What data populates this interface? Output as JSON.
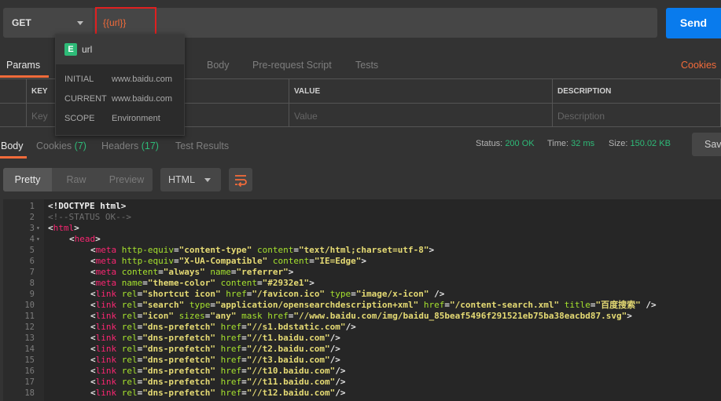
{
  "request": {
    "method": "GET",
    "url": "{{url}}",
    "send_label": "Send"
  },
  "request_tabs": [
    "Params",
    "Body",
    "Pre-request Script",
    "Tests"
  ],
  "cookies_link": "Cookies",
  "params_table": {
    "headers": [
      "KEY",
      "VALUE",
      "DESCRIPTION"
    ],
    "placeholders": [
      "Key",
      "Value",
      "Description"
    ]
  },
  "variable_popup": {
    "badge": "E",
    "variable": "url",
    "rows": [
      {
        "label": "INITIAL",
        "value": "www.baidu.com"
      },
      {
        "label": "CURRENT",
        "value": "www.baidu.com"
      },
      {
        "label": "SCOPE",
        "value": "Environment"
      }
    ]
  },
  "response_tabs": {
    "body": "Body",
    "cookies": "Cookies",
    "cookies_count": "(7)",
    "headers": "Headers",
    "headers_count": "(17)",
    "test_results": "Test Results"
  },
  "status": {
    "status_label": "Status:",
    "status_value": "200 OK",
    "time_label": "Time:",
    "time_value": "32 ms",
    "size_label": "Size:",
    "size_value": "150.02 KB"
  },
  "save_label": "Save",
  "view_modes": [
    "Pretty",
    "Raw",
    "Preview"
  ],
  "format": "HTML",
  "colors": {
    "accent": "#f26b3a",
    "send": "#097bed",
    "success": "#2ebb78",
    "highlight_box": "#e02020"
  },
  "code_lines": [
    {
      "n": "1",
      "fold": "",
      "indent": 0,
      "html": "<span class=\"p\">&lt;!DOCTYPE html&gt;</span>"
    },
    {
      "n": "2",
      "fold": "",
      "indent": 0,
      "html": "<span class=\"c\">&lt;!--STATUS OK--&gt;</span>"
    },
    {
      "n": "3",
      "fold": "▾",
      "indent": 0,
      "html": "&lt;<span class=\"t\">html</span>&gt;"
    },
    {
      "n": "4",
      "fold": "▾",
      "indent": 1,
      "html": "&lt;<span class=\"t\">head</span>&gt;"
    },
    {
      "n": "5",
      "fold": "",
      "indent": 2,
      "html": "&lt;<span class=\"t\">meta</span> <span class=\"a\">http-equiv</span>=<span class=\"s\">\"content-type\"</span> <span class=\"a\">content</span>=<span class=\"s\">\"text/html;charset=utf-8\"</span>&gt;"
    },
    {
      "n": "6",
      "fold": "",
      "indent": 2,
      "html": "&lt;<span class=\"t\">meta</span> <span class=\"a\">http-equiv</span>=<span class=\"s\">\"X-UA-Compatible\"</span> <span class=\"a\">content</span>=<span class=\"s\">\"IE=Edge\"</span>&gt;"
    },
    {
      "n": "7",
      "fold": "",
      "indent": 2,
      "html": "&lt;<span class=\"t\">meta</span> <span class=\"a\">content</span>=<span class=\"s\">\"always\"</span> <span class=\"a\">name</span>=<span class=\"s\">\"referrer\"</span>&gt;"
    },
    {
      "n": "8",
      "fold": "",
      "indent": 2,
      "html": "&lt;<span class=\"t\">meta</span> <span class=\"a\">name</span>=<span class=\"s\">\"theme-color\"</span> <span class=\"a\">content</span>=<span class=\"s\">\"#2932e1\"</span>&gt;"
    },
    {
      "n": "9",
      "fold": "",
      "indent": 2,
      "html": "&lt;<span class=\"t\">link</span> <span class=\"a\">rel</span>=<span class=\"s\">\"shortcut icon\"</span> <span class=\"a\">href</span>=<span class=\"s\">\"/favicon.ico\"</span> <span class=\"a\">type</span>=<span class=\"s\">\"image/x-icon\"</span> /&gt;"
    },
    {
      "n": "10",
      "fold": "",
      "indent": 2,
      "html": "&lt;<span class=\"t\">link</span> <span class=\"a\">rel</span>=<span class=\"s\">\"search\"</span> <span class=\"a\">type</span>=<span class=\"s\">\"application/opensearchdescription+xml\"</span> <span class=\"a\">href</span>=<span class=\"s\">\"/content-search.xml\"</span> <span class=\"a\">title</span>=<span class=\"s\">\"百度搜索\"</span> /&gt;"
    },
    {
      "n": "11",
      "fold": "",
      "indent": 2,
      "html": "&lt;<span class=\"t\">link</span> <span class=\"a\">rel</span>=<span class=\"s\">\"icon\"</span> <span class=\"a\">sizes</span>=<span class=\"s\">\"any\"</span> <span class=\"a\">mask</span> <span class=\"a\">href</span>=<span class=\"s\">\"//www.baidu.com/img/baidu_85beaf5496f291521eb75ba38eacbd87.svg\"</span>&gt;"
    },
    {
      "n": "12",
      "fold": "",
      "indent": 2,
      "html": "&lt;<span class=\"t\">link</span> <span class=\"a\">rel</span>=<span class=\"s\">\"dns-prefetch\"</span> <span class=\"a\">href</span>=<span class=\"s\">\"//s1.bdstatic.com\"</span>/&gt;"
    },
    {
      "n": "13",
      "fold": "",
      "indent": 2,
      "html": "&lt;<span class=\"t\">link</span> <span class=\"a\">rel</span>=<span class=\"s\">\"dns-prefetch\"</span> <span class=\"a\">href</span>=<span class=\"s\">\"//t1.baidu.com\"</span>/&gt;"
    },
    {
      "n": "14",
      "fold": "",
      "indent": 2,
      "html": "&lt;<span class=\"t\">link</span> <span class=\"a\">rel</span>=<span class=\"s\">\"dns-prefetch\"</span> <span class=\"a\">href</span>=<span class=\"s\">\"//t2.baidu.com\"</span>/&gt;"
    },
    {
      "n": "15",
      "fold": "",
      "indent": 2,
      "html": "&lt;<span class=\"t\">link</span> <span class=\"a\">rel</span>=<span class=\"s\">\"dns-prefetch\"</span> <span class=\"a\">href</span>=<span class=\"s\">\"//t3.baidu.com\"</span>/&gt;"
    },
    {
      "n": "16",
      "fold": "",
      "indent": 2,
      "html": "&lt;<span class=\"t\">link</span> <span class=\"a\">rel</span>=<span class=\"s\">\"dns-prefetch\"</span> <span class=\"a\">href</span>=<span class=\"s\">\"//t10.baidu.com\"</span>/&gt;"
    },
    {
      "n": "17",
      "fold": "",
      "indent": 2,
      "html": "&lt;<span class=\"t\">link</span> <span class=\"a\">rel</span>=<span class=\"s\">\"dns-prefetch\"</span> <span class=\"a\">href</span>=<span class=\"s\">\"//t11.baidu.com\"</span>/&gt;"
    },
    {
      "n": "18",
      "fold": "",
      "indent": 2,
      "html": "&lt;<span class=\"t\">link</span> <span class=\"a\">rel</span>=<span class=\"s\">\"dns-prefetch\"</span> <span class=\"a\">href</span>=<span class=\"s\">\"//t12.baidu.com\"</span>/&gt;"
    }
  ]
}
